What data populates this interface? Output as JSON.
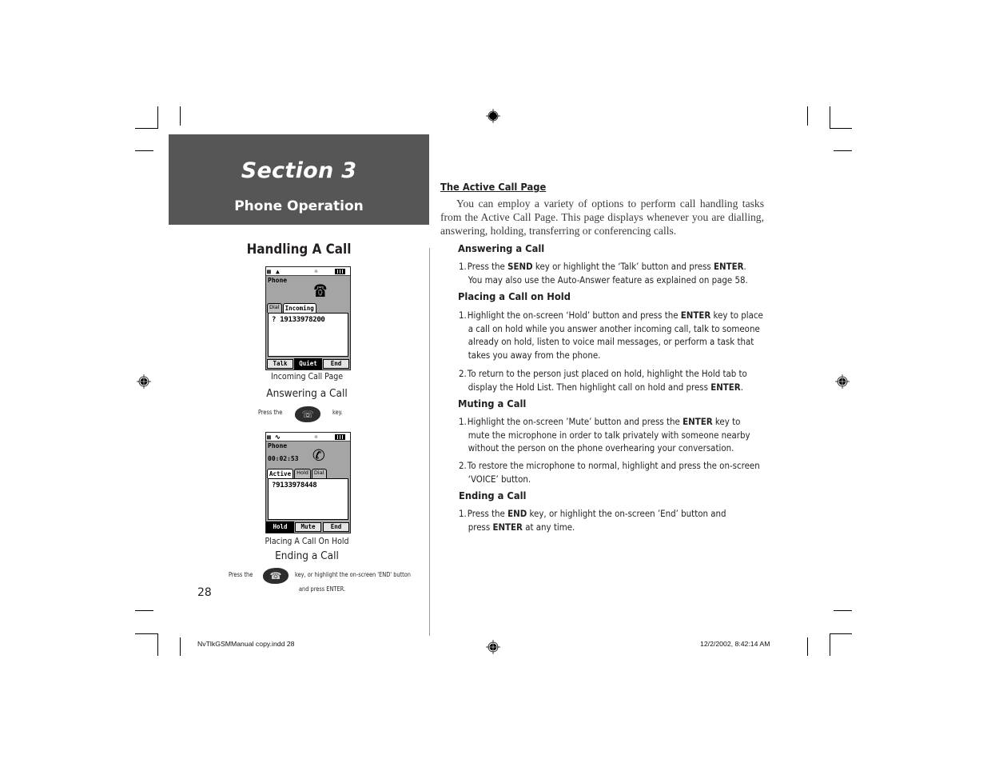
{
  "section": {
    "title": "Section 3",
    "subtitle": "Phone Operation"
  },
  "left": {
    "heading": "Handling A Call",
    "screen1": {
      "status_icons": [
        "signal-icon",
        "bell-icon",
        "backlight-icon",
        "battery-icon"
      ],
      "title": "Phone",
      "tabs": [
        "Dial",
        "Incoming"
      ],
      "active_tab": "Incoming",
      "number": "19133978200",
      "softkeys": [
        "Talk",
        "Quiet",
        "End"
      ],
      "selected_softkey": "Quiet",
      "caption": "Incoming Call Page"
    },
    "answering": {
      "heading": "Answering a Call",
      "press_the": "Press the",
      "key_icon": "send-key-icon",
      "suffix": "key."
    },
    "screen2": {
      "status_icons": [
        "signal-icon",
        "call-active-icon",
        "backlight-icon",
        "battery-icon"
      ],
      "title": "Phone",
      "timer": "00:02:53",
      "tabs": [
        "Active",
        "Hold",
        "Dial"
      ],
      "active_tab": "Active",
      "number": "9133978448",
      "softkeys": [
        "Hold",
        "Mute",
        "End"
      ],
      "selected_softkey": "Hold",
      "caption": "Placing A Call On Hold"
    },
    "ending": {
      "heading": "Ending a Call",
      "press_the": "Press the",
      "key_icon": "end-key-icon",
      "suffix_line1": "key, or highlight the on-screen 'END'  button",
      "suffix_line2": "and press ENTER."
    },
    "page_number": "28"
  },
  "right": {
    "title": "The Active Call Page",
    "intro": "You can employ a variety of options to perform call handling tasks from the Active Call Page. This page displays whenever you are dialling, answering, holding, transferring or conferencing calls.",
    "sections": [
      {
        "heading": "Answering a Call",
        "items": [
          {
            "num": "1.",
            "segments": [
              {
                "t": "Press the "
              },
              {
                "t": "SEND",
                "b": true
              },
              {
                "t": " key or highlight the ‘Talk’ button and press "
              },
              {
                "t": "ENTER",
                "b": true
              },
              {
                "t": "."
              }
            ],
            "cont": [
              {
                "t": "You may also use the Auto-Answer feature as explained on page 58."
              }
            ]
          }
        ]
      },
      {
        "heading": "Placing a Call on Hold",
        "items": [
          {
            "num": "1.",
            "segments": [
              {
                "t": "Highlight the on-screen ‘Hold’ button and press the "
              },
              {
                "t": "ENTER",
                "b": true
              },
              {
                "t": " key to place"
              }
            ],
            "cont": [
              {
                "t": "a call on hold while you answer another incoming call, talk to someone"
              }
            ],
            "cont2": "already on hold, listen to voice mail messages, or perform a task that",
            "cont3": "takes you away from the phone."
          },
          {
            "num": "2.",
            "segments": [
              {
                "t": "To return to the person just placed on hold, highlight the Hold tab to"
              }
            ],
            "cont": [
              {
                "t": "display the Hold List.  Then highlight call on hold and press "
              },
              {
                "t": "ENTER",
                "b": true
              },
              {
                "t": "."
              }
            ]
          }
        ]
      },
      {
        "heading": "Muting a Call",
        "items": [
          {
            "num": "1.",
            "segments": [
              {
                "t": "Highlight the on-screen ’Mute’ button and press the "
              },
              {
                "t": "ENTER",
                "b": true
              },
              {
                "t": " key to"
              }
            ],
            "cont": [
              {
                "t": "mute the microphone in order to talk privately with someone nearby"
              }
            ],
            "cont2": "without the person on the phone overhearing your conversation."
          },
          {
            "num": "2.",
            "segments": [
              {
                "t": "To restore the microphone to normal, highlight and press the on-screen"
              }
            ],
            "cont": [
              {
                "t": "‘VOICE’ button."
              }
            ]
          }
        ]
      },
      {
        "heading": "Ending a Call",
        "items": [
          {
            "num": "1.",
            "segments": [
              {
                "t": "Press the "
              },
              {
                "t": "END",
                "b": true
              },
              {
                "t": " key, or highlight the on-screen ’End’ button and"
              }
            ],
            "cont": [
              {
                "t": "press "
              },
              {
                "t": "ENTER",
                "b": true
              },
              {
                "t": " at any time."
              }
            ]
          }
        ]
      }
    ]
  },
  "slug": {
    "file": "NvTlkGSMManual copy.indd   28",
    "timestamp": "12/2/2002, 8:42:14 AM"
  }
}
